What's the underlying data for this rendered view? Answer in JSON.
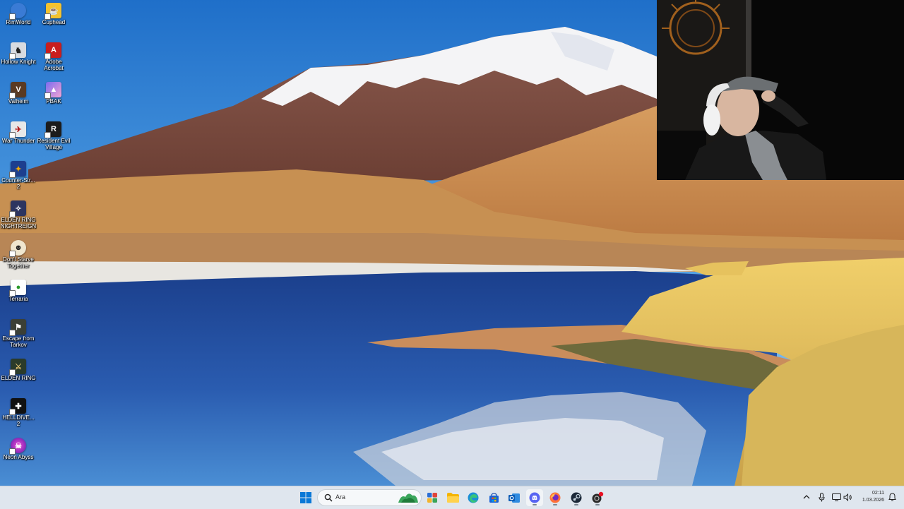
{
  "desktop": {
    "icons": [
      {
        "label": "RimWorld",
        "icon": "rimworld-icon"
      },
      {
        "label": "Cuphead",
        "icon": "cuphead-icon"
      },
      {
        "label": "Hollow Knight",
        "icon": "hollow-knight-icon"
      },
      {
        "label": "Adobe Acrobat",
        "icon": "adobe-acrobat-icon"
      },
      {
        "label": "Valheim",
        "icon": "valheim-icon"
      },
      {
        "label": "PBAK",
        "icon": "pbak-icon"
      },
      {
        "label": "War Thunder",
        "icon": "war-thunder-icon"
      },
      {
        "label": "Resident Evil Village",
        "icon": "resident-evil-village-icon"
      },
      {
        "label": "Counter-Str... 2",
        "icon": "counter-strike-icon"
      },
      {
        "label": "ELDEN RING NIGHTREIGN",
        "icon": "elden-ring-nightreign-icon"
      },
      {
        "label": "Don't Starve Together",
        "icon": "dont-starve-together-icon"
      },
      {
        "label": "Terraria",
        "icon": "terraria-icon"
      },
      {
        "label": "Escape from Tarkov",
        "icon": "escape-from-tarkov-icon"
      },
      {
        "label": "ELDEN RING",
        "icon": "elden-ring-icon"
      },
      {
        "label": "HELLDIVE... 2",
        "icon": "helldivers-icon"
      },
      {
        "label": "Neon Abyss",
        "icon": "neon-abyss-icon"
      }
    ]
  },
  "taskbar": {
    "search_placeholder": "Ara",
    "pinned": [
      {
        "icon": "start-icon"
      },
      {
        "icon": "search-icon"
      },
      {
        "icon": "widgets-icon"
      },
      {
        "icon": "file-explorer-icon"
      },
      {
        "icon": "edge-icon"
      },
      {
        "icon": "microsoft-store-icon"
      },
      {
        "icon": "outlook-icon"
      },
      {
        "icon": "discord-icon"
      },
      {
        "icon": "firefox-icon"
      },
      {
        "icon": "steam-icon"
      },
      {
        "icon": "app-with-badge-icon"
      }
    ],
    "tray": {
      "icons": [
        "chevron-up-icon",
        "microphone-icon",
        "network-icon",
        "volume-icon",
        "notification-icon"
      ],
      "time": "02:11",
      "date": "1.03.2026"
    }
  },
  "colors": {
    "sky": "#3d8ad6",
    "taskbar": "#dfe6ee",
    "accent": "#0067c0"
  }
}
